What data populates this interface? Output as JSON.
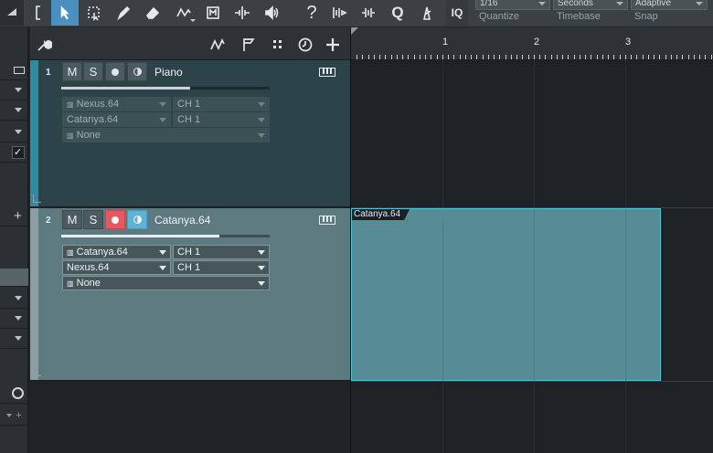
{
  "toolbar": {
    "quantize": {
      "value": "1/16",
      "label": "Quantize"
    },
    "timebase": {
      "value": "Seconds",
      "label": "Timebase"
    },
    "snap": {
      "value": "Adaptive",
      "label": "Snap"
    },
    "iq_label": "IQ",
    "help_label": "?",
    "quantize_tool_label": "Q"
  },
  "ruler": {
    "bars": [
      "1",
      "2",
      "3"
    ]
  },
  "tracks": [
    {
      "number": "1",
      "name": "Piano",
      "mute": "M",
      "solo": "S",
      "color": "#2e8ca0",
      "selected": false,
      "volume_fraction": 0.62,
      "input_instrument": "Nexus.64",
      "input_channel": "CH 1",
      "output_instrument": "Catanya.64",
      "output_channel": "CH 1",
      "insert": "None"
    },
    {
      "number": "2",
      "name": "Catanya.64",
      "mute": "M",
      "solo": "S",
      "color": "#8a9ea3",
      "selected": true,
      "volume_fraction": 0.76,
      "input_instrument": "Catanya.64",
      "input_channel": "CH 1",
      "output_instrument": "Nexus.64",
      "output_channel": "CH 1",
      "insert": "None"
    }
  ],
  "events": [
    {
      "name": "Catanya.64",
      "track": "2"
    }
  ],
  "colors": {
    "record_active": "#e4585f",
    "monitor_active": "#5cb3d6",
    "event_fill": "#578b96",
    "event_border": "#4ec3d6",
    "tool_active": "#4a8fc0"
  }
}
